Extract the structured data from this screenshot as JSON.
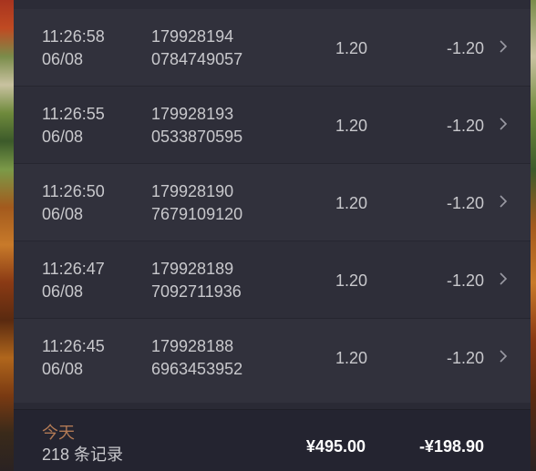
{
  "transactions": [
    {
      "time": "11:26:58",
      "date": "06/08",
      "order_line1": "179928194",
      "order_line2": "0784749057",
      "amount": "1.20",
      "net": "-1.20"
    },
    {
      "time": "11:26:55",
      "date": "06/08",
      "order_line1": "179928193",
      "order_line2": "0533870595",
      "amount": "1.20",
      "net": "-1.20"
    },
    {
      "time": "11:26:50",
      "date": "06/08",
      "order_line1": "179928190",
      "order_line2": "7679109120",
      "amount": "1.20",
      "net": "-1.20"
    },
    {
      "time": "11:26:47",
      "date": "06/08",
      "order_line1": "179928189",
      "order_line2": "7092711936",
      "amount": "1.20",
      "net": "-1.20"
    },
    {
      "time": "11:26:45",
      "date": "06/08",
      "order_line1": "179928188",
      "order_line2": "6963453952",
      "amount": "1.20",
      "net": "-1.20"
    }
  ],
  "summary": {
    "period_label": "今天",
    "record_count": "218 条记录",
    "total": "¥495.00",
    "net_total": "-¥198.90"
  },
  "icons": {
    "row_arrow": "chevron-right-icon"
  },
  "colors": {
    "period_label": "#b27a55",
    "panel_bg": "#2a2a35"
  }
}
